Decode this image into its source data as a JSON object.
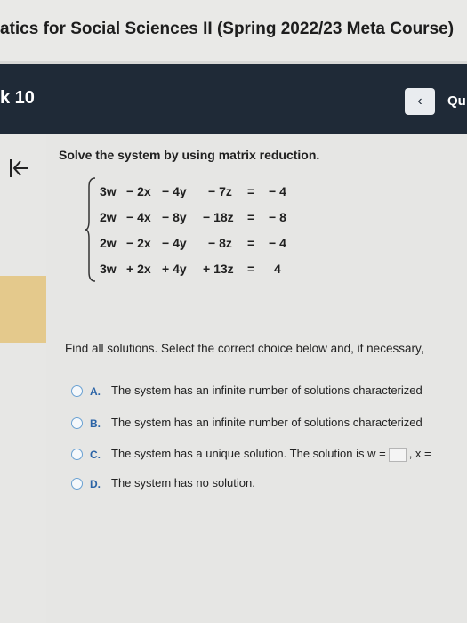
{
  "course": {
    "title": "atics for Social Sciences II (Spring 2022/23 Meta Course)"
  },
  "nav": {
    "homework": "k 10",
    "prev_label": "‹",
    "question_label": "Qu"
  },
  "question": {
    "instruction": "Solve the system by using matrix reduction.",
    "equations": [
      {
        "w": "3w",
        "x": "− 2x",
        "y": "− 4y",
        "z": "− 7z",
        "eq": "=",
        "rhs": "− 4"
      },
      {
        "w": "2w",
        "x": "− 4x",
        "y": "− 8y",
        "z": "− 18z",
        "eq": "=",
        "rhs": "− 8"
      },
      {
        "w": "2w",
        "x": "− 2x",
        "y": "− 4y",
        "z": "− 8z",
        "eq": "=",
        "rhs": "− 4"
      },
      {
        "w": "3w",
        "x": "+ 2x",
        "y": "+ 4y",
        "z": "+ 13z",
        "eq": "=",
        "rhs": "4"
      }
    ],
    "prompt": "Find all solutions. Select the correct choice below and, if necessary,",
    "choices": [
      {
        "letter": "A.",
        "text": "The system has an infinite number of solutions characterized"
      },
      {
        "letter": "B.",
        "text": "The system has an infinite number of solutions characterized"
      },
      {
        "letter": "C.",
        "text_before": "The system has a unique solution. The solution is w =",
        "text_after": ", x ="
      },
      {
        "letter": "D.",
        "text": "The system has no solution."
      }
    ]
  }
}
